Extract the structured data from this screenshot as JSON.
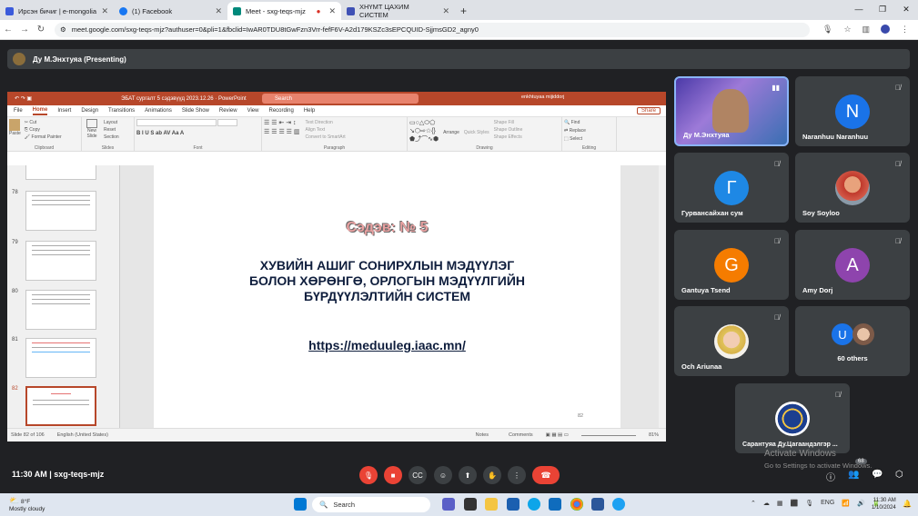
{
  "browser": {
    "tabs": [
      {
        "label": "Ирсэн бичиг | e-mongolia",
        "color": "#3b5bdb"
      },
      {
        "label": "(1) Facebook",
        "color": "#1877f2"
      },
      {
        "label": "Meet - sxg-teqs-mjz",
        "color": "#00897b"
      },
      {
        "label": "ХНҮМТ ЦАХИМ СИСТЕМ",
        "color": "#3f51b5"
      }
    ],
    "new_tab": "+",
    "url": "meet.google.com/sxg-teqs-mjz?authuser=0&pli=1&fbclid=IwAR0TDU8tGwFzn3Vrr-fefF6V-A2d179KSZc3sEPCQUID-SjjmsGD2_agny0"
  },
  "meet": {
    "presenter": "Ду М.Энхтуяа (Presenting)",
    "time": "11:30 AM",
    "meeting_code": "sxg-teqs-mjz",
    "participants_badge": "68",
    "tiles": [
      {
        "name": "Ду М.Энхтуяа",
        "type": "video"
      },
      {
        "name": "Naranhuu Naranhuu",
        "initial": "N",
        "color": "#1a73e8"
      },
      {
        "name": "Гурвансайхан сум",
        "initial": "Г",
        "color": "#1e88e5"
      },
      {
        "name": "Soy Soyloo",
        "type": "photo"
      },
      {
        "name": "Gantuya Tsend",
        "initial": "G",
        "color": "#f57c00"
      },
      {
        "name": "Amy Dorj",
        "initial": "A",
        "color": "#8e44ad"
      },
      {
        "name": "Och Ariunaa",
        "type": "photo"
      },
      {
        "name": "60 others",
        "initial": "U"
      },
      {
        "name": "Сарантуяа Ду.Цагаандэлгэр ...",
        "type": "logo"
      }
    ]
  },
  "ppt": {
    "title_bar": "ЭБАТ сургалт 5 сэдэвүүд 2023.12.26 · PowerPoint",
    "search": "Search",
    "user": "enkhtuyaa mijiddorj",
    "menu": [
      "File",
      "Home",
      "Insert",
      "Design",
      "Transitions",
      "Animations",
      "Slide Show",
      "Review",
      "View",
      "Recording",
      "Help"
    ],
    "share": "Share",
    "groups": [
      "Clipboard",
      "Slides",
      "Font",
      "Paragraph",
      "Drawing",
      "Editing"
    ],
    "ribbon_items": {
      "paste": "Paste",
      "cut": "Cut",
      "copy": "Copy",
      "format_painter": "Format Painter",
      "new_slide": "New Slide",
      "layout": "Layout",
      "reset": "Reset",
      "section": "Section",
      "text_direction": "Text Direction",
      "align_text": "Align Text",
      "convert": "Convert to SmartArt",
      "arrange": "Arrange",
      "quick_styles": "Quick Styles",
      "shape_fill": "Shape Fill",
      "shape_outline": "Shape Outline",
      "shape_effects": "Shape Effects",
      "find": "Find",
      "replace": "Replace",
      "select": "Select"
    },
    "thumbs": [
      "78",
      "79",
      "80",
      "81",
      "82"
    ],
    "slide": {
      "title": "Сэдэв: № 5",
      "body": [
        "ХУВИЙН АШИГ СОНИРХЛЫН МЭДҮҮЛЭГ",
        "БОЛОН ХӨРӨНГӨ, ОРЛОГЫН МЭДҮҮЛГИЙН",
        "БҮРДҮҮЛЭЛТИЙН СИСТЕМ"
      ],
      "link": "https://meduuleg.iaac.mn/",
      "page": "82"
    },
    "status": {
      "slide": "Slide 82 of 106",
      "lang": "English (United States)",
      "notes": "Notes",
      "comments": "Comments",
      "zoom": "81%"
    }
  },
  "os": {
    "watermark_title": "Activate Windows",
    "watermark_sub": "Go to Settings to activate Windows.",
    "weather_temp": "8°F",
    "weather_desc": "Mostly cloudy",
    "search": "Search",
    "tray_lang": "ENG",
    "clock_time": "11:30 AM",
    "clock_date": "1/10/2024"
  }
}
